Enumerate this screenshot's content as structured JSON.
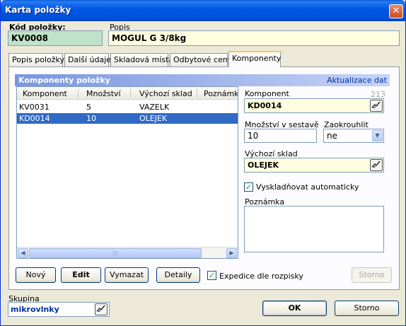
{
  "window": {
    "title": "Karta položky",
    "close_glyph": "✕"
  },
  "header": {
    "code_label": "Kód položky:",
    "code_value": "KV0008",
    "desc_label": "Popis",
    "desc_value": "MOGUL G 3/8kg"
  },
  "tabs": [
    {
      "label": "Popis položky"
    },
    {
      "label": "Další údaje"
    },
    {
      "label": "Skladová místa"
    },
    {
      "label": "Odbytové ceny"
    },
    {
      "label": "Komponenty"
    }
  ],
  "active_tab": "Komponenty",
  "section": {
    "title": "Komponenty položky",
    "refresh_link": "Aktualizace dat"
  },
  "table": {
    "columns": [
      "Komponent",
      "Množství",
      "Výchozí sklad",
      "Poznámk"
    ],
    "rows": [
      {
        "komponent": "KV0031",
        "mnozstvi": "5",
        "sklad": "VAZELK",
        "selected": false
      },
      {
        "komponent": "KD0014",
        "mnozstvi": "10",
        "sklad": "OLEJEK",
        "selected": true
      }
    ],
    "scroll_left": "◀",
    "scroll_right": "▶",
    "scroll_grip": "|||"
  },
  "detail": {
    "komponent_label": "Komponent",
    "komponent_counter": "213",
    "komponent_value": "KD0014",
    "mnozstvi_label": "Množství v sestavě",
    "mnozstvi_value": "10",
    "zaokrouhlit_label": "Zaokrouhlit",
    "zaokrouhlit_value": "ne",
    "sklad_label": "Výchozí sklad",
    "sklad_value": "OLEJEK",
    "auto_label": "Vyskladňovat automaticky",
    "auto_checked": true,
    "poznamka_label": "Poznámka",
    "poznamka_value": ""
  },
  "buttons": {
    "new": "Nový",
    "edit": "Edit",
    "delete": "Vymazat",
    "details": "Detaily",
    "expedice_label": "Expedice dle rozpisky",
    "expedice_checked": true,
    "storno_inner": "Storno",
    "ok": "OK",
    "storno": "Storno"
  },
  "group": {
    "label": "Skupina",
    "value": "mikrovlnky"
  },
  "icons": {
    "lookup": "pen-lookup-icon",
    "check": "checkmark-icon",
    "dropdown": "chevron-down-icon"
  },
  "colors": {
    "accent": "#0058e6",
    "selection": "#316ac5",
    "code_bg": "#bfe2c8",
    "field_bg": "#fffde0"
  }
}
